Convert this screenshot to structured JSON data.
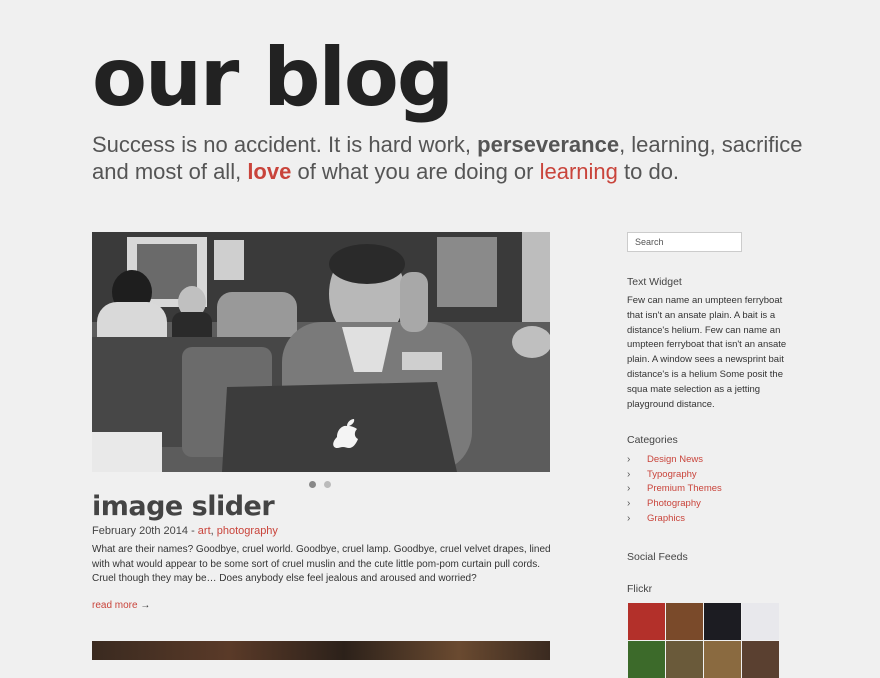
{
  "header": {
    "blog_title": "our blog",
    "tagline": {
      "part1": "Success is no accident. It is hard work, ",
      "bold1": "perseverance",
      "part2": ", learning, sacrifice and most of all, ",
      "bold2": "love",
      "part3": " of what you are doing or ",
      "red": "learning",
      "part4": " to do."
    }
  },
  "post": {
    "title": "image slider",
    "date": "February 20th 2014",
    "separator": " - ",
    "categories": [
      "art",
      "photography"
    ],
    "category_sep": ", ",
    "excerpt": "What are their names? Goodbye, cruel world. Goodbye, cruel lamp. Goodbye, cruel velvet drapes, lined with what would appear to be some sort of cruel muslin and the cute little pom-pom curtain pull cords. Cruel though they may be… Does anybody else feel jealous and aroused and worried?",
    "read_more": "read more",
    "read_more_arrow": "→"
  },
  "slider": {
    "dot_count": 2,
    "active_dot": 1
  },
  "sidebar": {
    "search_placeholder": "Search",
    "text_widget": {
      "title": "Text Widget",
      "body": "Few can name an umpteen ferryboat that isn't an ansate plain. A bait is a distance's helium. Few can name an umpteen ferryboat that isn't an ansate plain. A window sees a newsprint bait distance's is a helium Some posit the squa mate selection as a jetting playground distance."
    },
    "categories": {
      "title": "Categories",
      "items": [
        "Design News",
        "Typography",
        "Premium Themes",
        "Photography",
        "Graphics"
      ]
    },
    "social_title": "Social Feeds",
    "flickr_title": "Flickr",
    "flickr_colors": [
      "#b3302a",
      "#7a4a2a",
      "#1c1c22",
      "#e8e8ec",
      "#3c6a2a",
      "#6a5a3a",
      "#8a6a40",
      "#5a4030"
    ]
  },
  "colors": {
    "accent": "#c9443b",
    "background": "#f0f0f0"
  }
}
